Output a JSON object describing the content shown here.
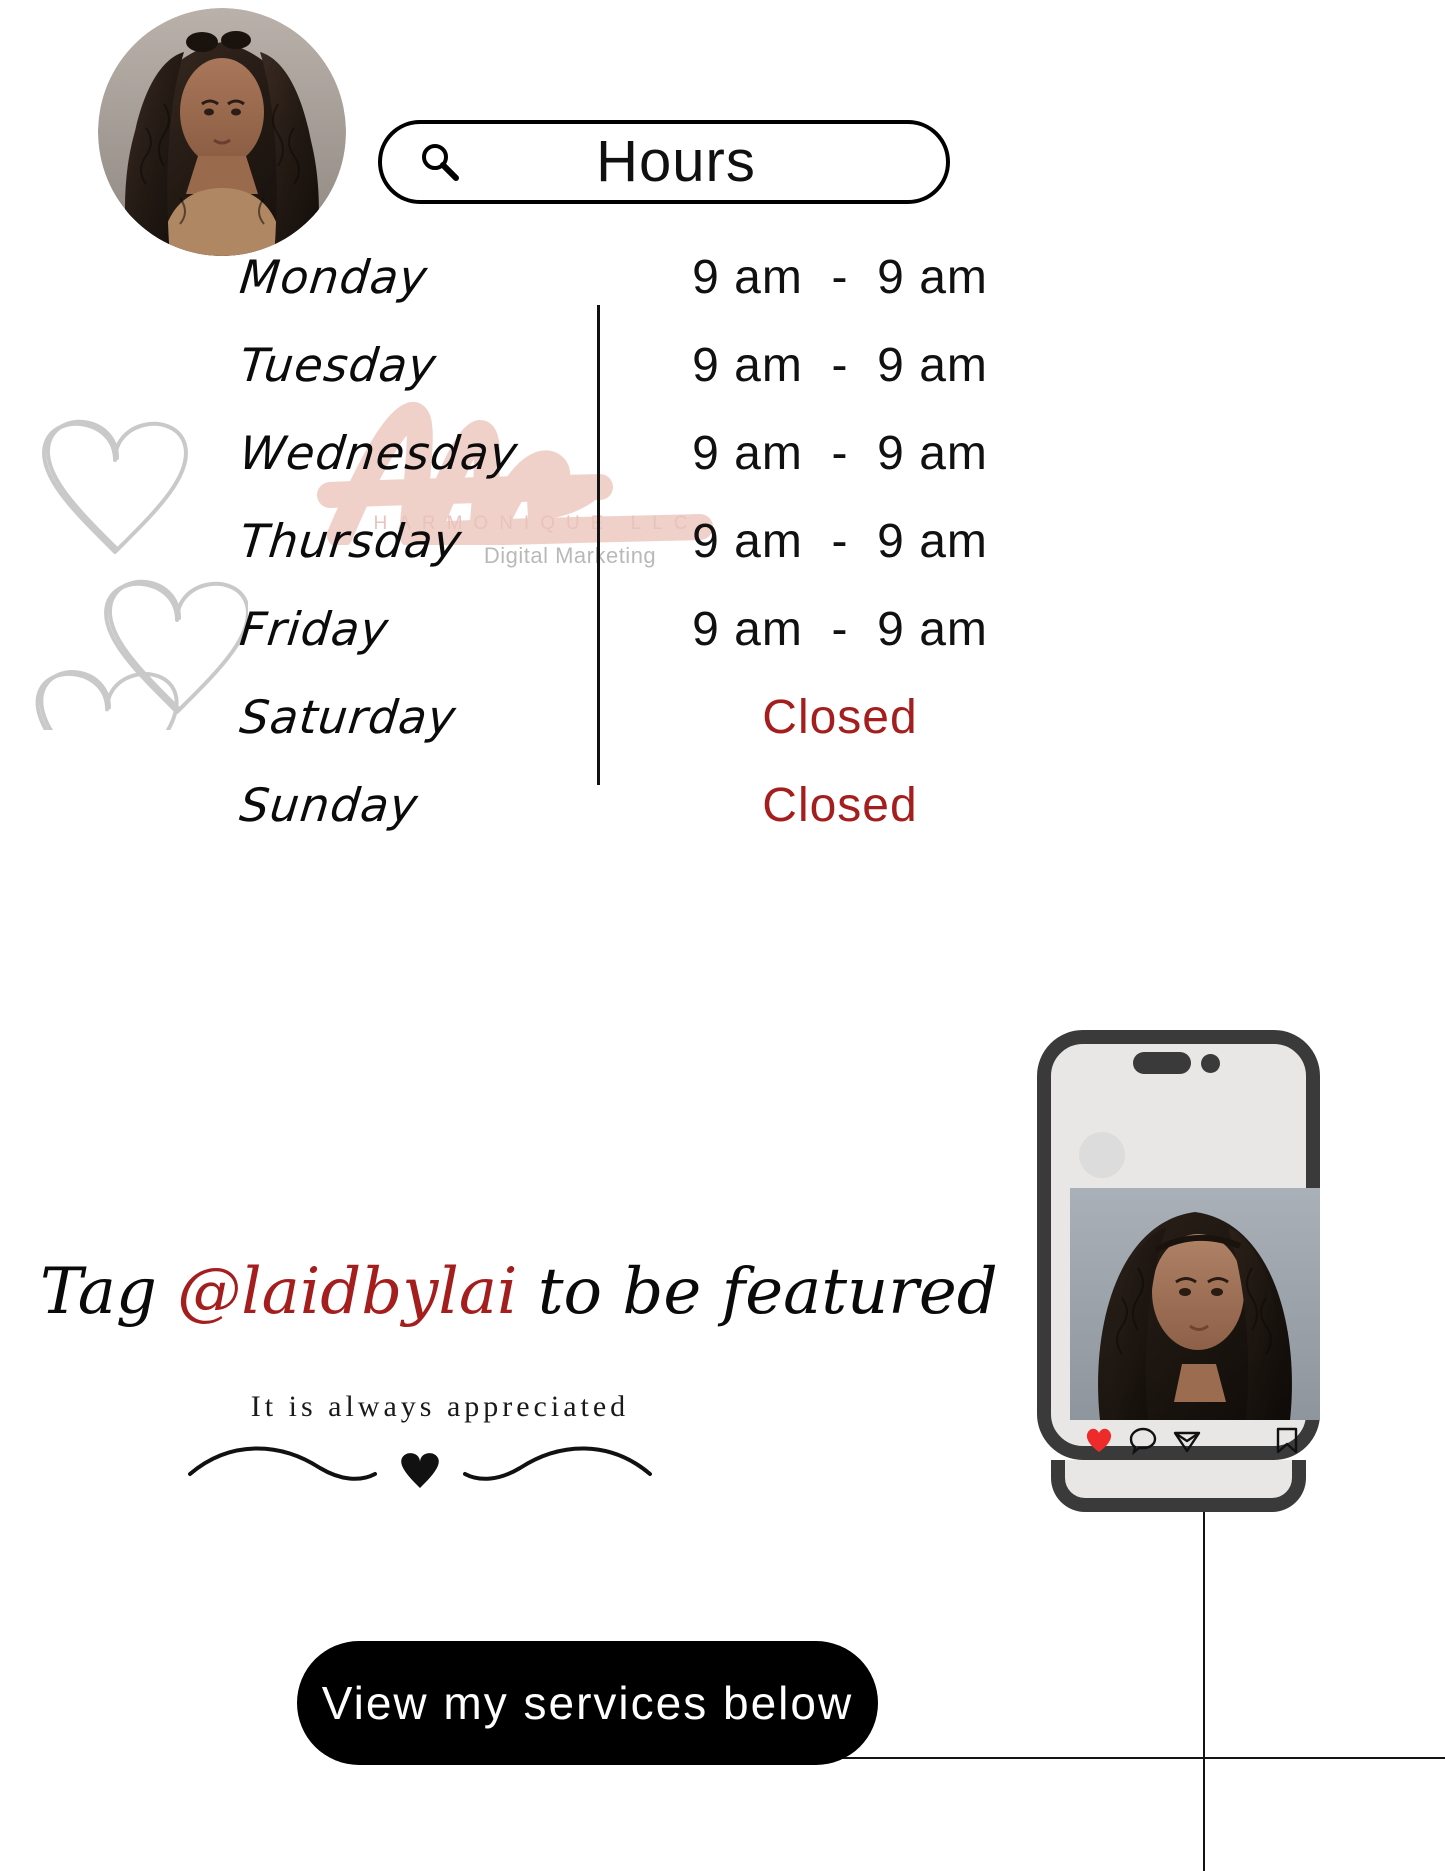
{
  "search": {
    "title": "Hours",
    "icon": "search-icon"
  },
  "profile": {
    "avatar_alt": "profile-photo"
  },
  "watermark": {
    "brand": "HARMONIQUE LLC",
    "tagline": "Digital Marketing",
    "brand_color": "#e8c3bc",
    "tagline_color": "#b9b9b9"
  },
  "hours": {
    "rows": [
      {
        "day": "Monday",
        "time": "9 am  -  9 am",
        "closed": false
      },
      {
        "day": "Tuesday",
        "time": "9 am  -  9 am",
        "closed": false
      },
      {
        "day": "Wednesday",
        "time": "9 am  -  9 am",
        "closed": false
      },
      {
        "day": "Thursday",
        "time": "9 am  -  9 am",
        "closed": false
      },
      {
        "day": "Friday",
        "time": "9 am  -  9 am",
        "closed": false
      },
      {
        "day": "Saturday",
        "time": "Closed",
        "closed": true
      },
      {
        "day": "Sunday",
        "time": "Closed",
        "closed": true
      }
    ],
    "closed_color": "#a51e1e"
  },
  "tag": {
    "prefix": "Tag ",
    "handle": "@laidbylai",
    "suffix": " to be featured",
    "handle_color": "#a51e1e",
    "subtitle": "It is always appreciated"
  },
  "cta": {
    "label": "View my services below",
    "background": "#000000",
    "text_color": "#ffffff"
  },
  "phone": {
    "icons": {
      "like": "heart-icon",
      "comment": "comment-icon",
      "share": "share-icon",
      "save": "bookmark-icon"
    },
    "like_color": "#ed2b2b"
  }
}
